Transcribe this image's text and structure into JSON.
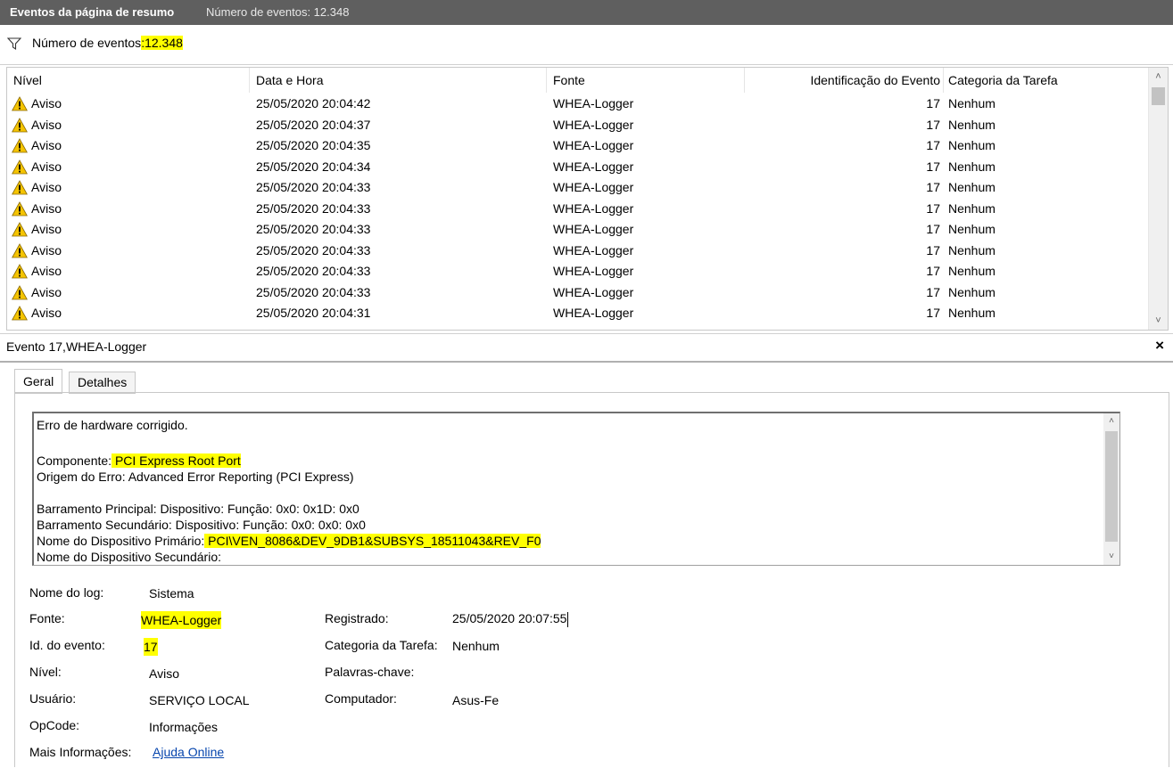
{
  "titlebar": {
    "title": "Eventos da página de resumo",
    "event_count": "Número de eventos: 12.348"
  },
  "filter": {
    "label_prefix": "Número de eventos",
    "label_sep": ":",
    "label_count": "12.348"
  },
  "columns": [
    "Nível",
    "Data e Hora",
    "Fonte",
    "Identificação do Evento",
    "Categoria da Tarefa"
  ],
  "rows": [
    {
      "level": "Aviso",
      "datetime": "25/05/2020 20:04:42",
      "source": "WHEA-Logger",
      "id": "17",
      "category": "Nenhum"
    },
    {
      "level": "Aviso",
      "datetime": "25/05/2020 20:04:37",
      "source": "WHEA-Logger",
      "id": "17",
      "category": "Nenhum"
    },
    {
      "level": "Aviso",
      "datetime": "25/05/2020 20:04:35",
      "source": "WHEA-Logger",
      "id": "17",
      "category": "Nenhum"
    },
    {
      "level": "Aviso",
      "datetime": "25/05/2020 20:04:34",
      "source": "WHEA-Logger",
      "id": "17",
      "category": "Nenhum"
    },
    {
      "level": "Aviso",
      "datetime": "25/05/2020 20:04:33",
      "source": "WHEA-Logger",
      "id": "17",
      "category": "Nenhum"
    },
    {
      "level": "Aviso",
      "datetime": "25/05/2020 20:04:33",
      "source": "WHEA-Logger",
      "id": "17",
      "category": "Nenhum"
    },
    {
      "level": "Aviso",
      "datetime": "25/05/2020 20:04:33",
      "source": "WHEA-Logger",
      "id": "17",
      "category": "Nenhum"
    },
    {
      "level": "Aviso",
      "datetime": "25/05/2020 20:04:33",
      "source": "WHEA-Logger",
      "id": "17",
      "category": "Nenhum"
    },
    {
      "level": "Aviso",
      "datetime": "25/05/2020 20:04:33",
      "source": "WHEA-Logger",
      "id": "17",
      "category": "Nenhum"
    },
    {
      "level": "Aviso",
      "datetime": "25/05/2020 20:04:33",
      "source": "WHEA-Logger",
      "id": "17",
      "category": "Nenhum"
    },
    {
      "level": "Aviso",
      "datetime": "25/05/2020 20:04:31",
      "source": "WHEA-Logger",
      "id": "17",
      "category": "Nenhum"
    }
  ],
  "detail": {
    "title": "Evento 17,WHEA-Logger",
    "close": "×",
    "tabs": [
      "Geral",
      "Detalhes"
    ],
    "description": {
      "line1": "Erro de hardware corrigido.",
      "component_label": "Componente:",
      "component_value": " PCI Express Root Port ",
      "origin": "Origem do Erro: Advanced Error Reporting (PCI Express)",
      "bus_primary": "Barramento Principal: Dispositivo: Função: 0x0: 0x1D: 0x0",
      "bus_secondary": "Barramento Secundário: Dispositivo: Função: 0x0: 0x0: 0x0",
      "primary_device_label": "Nome do Dispositivo Primário:",
      "primary_device_value": " PCI\\VEN_8086&DEV_9DB1&SUBSYS_18511043&REV_F0 ",
      "secondary_device": "Nome do Dispositivo Secundário:"
    },
    "fields": {
      "log_name_label": "Nome do log:",
      "log_name": "Sistema",
      "source_label": "Fonte:",
      "source": " WHEA-Logger ",
      "event_id_label": "Id. do evento:",
      "event_id": " 17 ",
      "level_label": "Nível:",
      "level": "Aviso",
      "user_label": "Usuário:",
      "user": "SERVIÇO LOCAL",
      "opcode_label": "OpCode:",
      "opcode": "Informações",
      "more_info_label": "Mais Informações:",
      "more_info_link": "Ajuda Online",
      "logged_label": "Registrado:",
      "logged": "25/05/2020 20:07:55",
      "task_category_label": "Categoria da Tarefa:",
      "task_category": "Nenhum",
      "keywords_label": "Palavras-chave:",
      "keywords": "",
      "computer_label": "Computador:",
      "computer": "Asus-Fe"
    }
  },
  "colors": {
    "titlebar": "#5f5f5f",
    "highlight": "#ffff00",
    "link": "#0645ad",
    "warning": "#f5c400"
  }
}
